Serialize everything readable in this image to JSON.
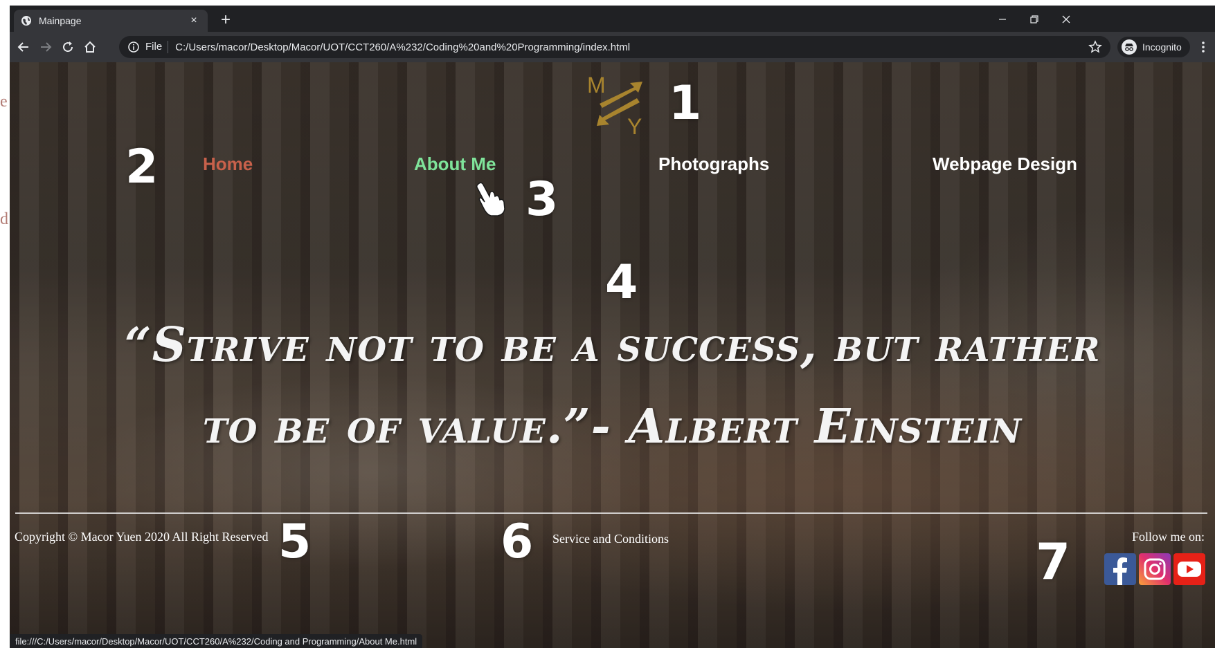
{
  "page_edge": {
    "glyph_top": "e",
    "glyph_bottom": "d"
  },
  "browser": {
    "tab": {
      "title": "Mainpage",
      "close": "×"
    },
    "new_tab": "+",
    "address": {
      "scheme": "File",
      "url": "C:/Users/macor/Desktop/Macor/UOT/CCT260/A%232/Coding%20and%20Programming/index.html"
    },
    "profile_label": "Incognito",
    "status_url": "file:///C:/Users/macor/Desktop/Macor/UOT/CCT260/A%232/Coding and Programming/About Me.html"
  },
  "site": {
    "logo": {
      "letter_top": "M",
      "letter_bottom": "Y",
      "color": "#a8842e"
    },
    "nav": [
      {
        "label": "Home",
        "color": "#c8614b"
      },
      {
        "label": "About Me",
        "color": "#7fe39a"
      },
      {
        "label": "Photographs",
        "color": "#ffffff"
      },
      {
        "label": "Webpage Design",
        "color": "#ffffff"
      }
    ],
    "quote_line1": "“Strive not to be a success, but rather",
    "quote_line2": "to be of value.”- Albert Einstein",
    "copyright": "Copyright © Macor Yuen 2020 All Right Reserved",
    "service": "Service and Conditions",
    "follow": "Follow me on:",
    "social": [
      "facebook-icon",
      "instagram-icon",
      "youtube-icon"
    ]
  },
  "markers": [
    "1",
    "2",
    "3",
    "4",
    "5",
    "6",
    "7"
  ]
}
